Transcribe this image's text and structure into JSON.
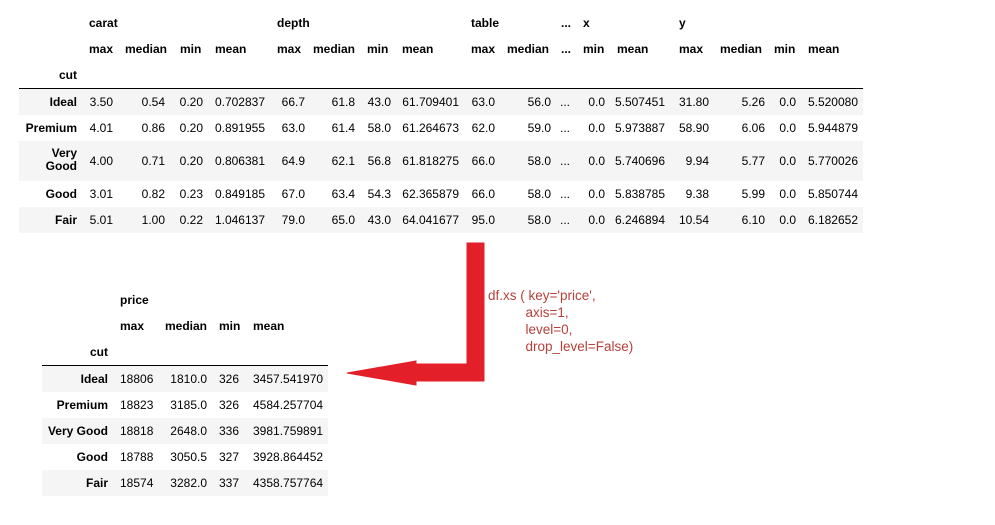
{
  "top_table": {
    "groups": [
      "carat",
      "depth",
      "table",
      "...",
      "x",
      "y"
    ],
    "subcols": [
      "max",
      "median",
      "min",
      "mean",
      "max",
      "median",
      "min",
      "mean",
      "max",
      "median",
      "...",
      "min",
      "mean",
      "max",
      "median",
      "min",
      "mean"
    ],
    "index_name": "cut",
    "rows": [
      {
        "label": "Ideal",
        "values": [
          "3.50",
          "0.54",
          "0.20",
          "0.702837",
          "66.7",
          "61.8",
          "43.0",
          "61.709401",
          "63.0",
          "56.0",
          "...",
          "0.0",
          "5.507451",
          "31.80",
          "5.26",
          "0.0",
          "5.520080"
        ]
      },
      {
        "label": "Premium",
        "values": [
          "4.01",
          "0.86",
          "0.20",
          "0.891955",
          "63.0",
          "61.4",
          "58.0",
          "61.264673",
          "62.0",
          "59.0",
          "...",
          "0.0",
          "5.973887",
          "58.90",
          "6.06",
          "0.0",
          "5.944879"
        ]
      },
      {
        "label_lines": [
          "Very",
          "Good"
        ],
        "values": [
          "4.00",
          "0.71",
          "0.20",
          "0.806381",
          "64.9",
          "62.1",
          "56.8",
          "61.818275",
          "66.0",
          "58.0",
          "...",
          "0.0",
          "5.740696",
          "9.94",
          "5.77",
          "0.0",
          "5.770026"
        ]
      },
      {
        "label": "Good",
        "values": [
          "3.01",
          "0.82",
          "0.23",
          "0.849185",
          "67.0",
          "63.4",
          "54.3",
          "62.365879",
          "66.0",
          "58.0",
          "...",
          "0.0",
          "5.838785",
          "9.38",
          "5.99",
          "0.0",
          "5.850744"
        ]
      },
      {
        "label": "Fair",
        "values": [
          "5.01",
          "1.00",
          "0.22",
          "1.046137",
          "79.0",
          "65.0",
          "43.0",
          "64.041677",
          "95.0",
          "58.0",
          "...",
          "0.0",
          "6.246894",
          "10.54",
          "6.10",
          "0.0",
          "6.182652"
        ]
      }
    ]
  },
  "bottom_table": {
    "group": "price",
    "subcols": [
      "max",
      "median",
      "min",
      "mean"
    ],
    "index_name": "cut",
    "rows": [
      {
        "label": "Ideal",
        "values": [
          "18806",
          "1810.0",
          "326",
          "3457.541970"
        ]
      },
      {
        "label": "Premium",
        "values": [
          "18823",
          "3185.0",
          "326",
          "4584.257704"
        ]
      },
      {
        "label": "Very Good",
        "values": [
          "18818",
          "2648.0",
          "336",
          "3981.759891"
        ]
      },
      {
        "label": "Good",
        "values": [
          "18788",
          "3050.5",
          "327",
          "3928.864452"
        ]
      },
      {
        "label": "Fair",
        "values": [
          "18574",
          "3282.0",
          "337",
          "4358.757764"
        ]
      }
    ]
  },
  "annotation": {
    "lines": [
      "df.xs ( key='price',",
      "axis=1,",
      "level=0,",
      "drop_level=False)"
    ],
    "color": "#b5403a"
  },
  "colors": {
    "arrow": "#e3202a",
    "stripe": "#f5f5f5"
  }
}
